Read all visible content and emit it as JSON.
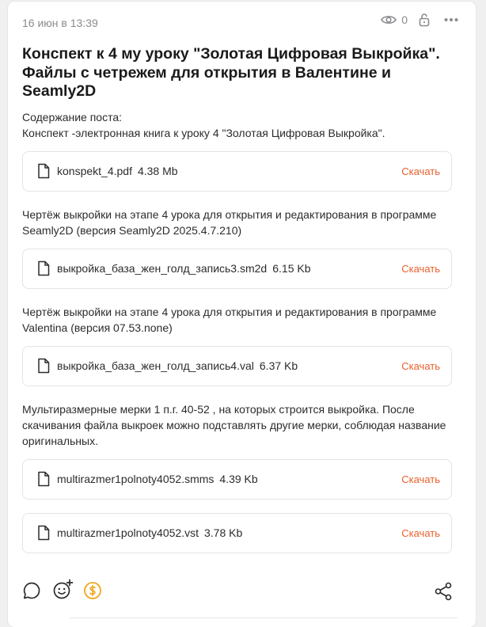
{
  "post": {
    "date": "16 июн в 13:39",
    "views": "0",
    "title": "Конспект к 4 му уроку \"Золотая Цифровая Выкройка\". Файлы с четрежем для открытия в Валентине и Seamly2D",
    "content_heading": "Содержание поста:",
    "content_line": "Конспект -электронная книга к уроку 4 \"Золотая Цифровая Выкройка\".",
    "para2": "Чертёж выкройки на этапе 4 урока для открытия и редактирования в программе Seamly2D (версия Seamly2D 2025.4.7.210)",
    "para3": "Чертёж выкройки на этапе 4 урока для открытия и редактирования в программе Valentina (версия 07.53.none)",
    "para4": "Мультиразмерные мерки 1 п.г. 40-52 , на которых строится выкройка. После скачивания файла выкроек можно подставлять другие мерки, соблюдая название оригинальных."
  },
  "download_label": "Скачать",
  "files": [
    {
      "name": "konspekt_4.pdf",
      "size": "4.38 Mb"
    },
    {
      "name": "выкройка_база_жен_голд_запись3.sm2d",
      "size": "6.15 Kb"
    },
    {
      "name": "выкройка_база_жен_голд_запись4.val",
      "size": "6.37 Kb"
    },
    {
      "name": "multirazmer1polnoty4052.smms",
      "size": "4.39 Kb"
    },
    {
      "name": "multirazmer1polnoty4052.vst",
      "size": "3.78 Kb"
    }
  ],
  "icons": {
    "views": "eye-icon",
    "lock": "lock-icon",
    "more": "more-icon",
    "file": "document-icon",
    "comment": "comment-icon",
    "reaction": "add-reaction-icon",
    "donate": "donate-icon",
    "share": "share-icon"
  },
  "colors": {
    "accent": "#e8602c",
    "donate": "#f0a81c",
    "muted": "#8b8b90"
  }
}
